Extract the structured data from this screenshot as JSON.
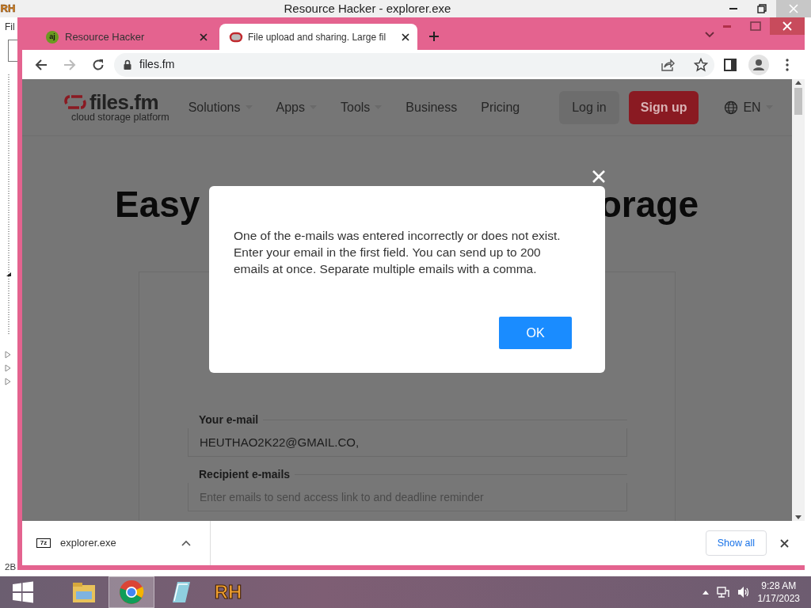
{
  "background_window": {
    "icon_text": "RH",
    "title": "Resource Hacker - explorer.exe",
    "menu_fragment": "Fil",
    "status_fragment": "2B"
  },
  "browser": {
    "tabs": [
      {
        "title": "Resource Hacker",
        "favicon_text": "aj",
        "selected": false
      },
      {
        "title": "File upload and sharing. Large fil",
        "selected": true
      }
    ],
    "address": "files.fm"
  },
  "page": {
    "logo": {
      "name": "files.fm",
      "tagline": "cloud storage platform"
    },
    "nav": [
      {
        "label": "Solutions",
        "dropdown": true
      },
      {
        "label": "Apps",
        "dropdown": true
      },
      {
        "label": "Tools",
        "dropdown": true
      },
      {
        "label": "Business",
        "dropdown": false
      },
      {
        "label": "Pricing",
        "dropdown": false
      }
    ],
    "login": "Log in",
    "signup": "Sign up",
    "language": "EN",
    "headline_start": "Easy",
    "headline_end": "orage",
    "fields": [
      {
        "label": "Your e-mail",
        "value": "HEUTHAO2K22@GMAIL.CO,"
      },
      {
        "label": "Recipient e-mails",
        "placeholder": "Enter emails to send access link to and deadline reminder"
      }
    ]
  },
  "dialog": {
    "message": "One of the e-mails was entered incorrectly or does not exist. Enter your email in the first field. You can send up to 200 emails at once. Separate multiple emails with a comma.",
    "button": "OK"
  },
  "downloads": {
    "items": [
      {
        "icon_text": "7z",
        "name": "explorer.exe"
      }
    ],
    "show_all": "Show all"
  },
  "taskbar": {
    "apps": [
      {
        "kind": "folder",
        "selected": false
      },
      {
        "kind": "chrome",
        "selected": true
      },
      {
        "kind": "notepad",
        "selected": false
      },
      {
        "kind": "text",
        "label": "RH",
        "selected": false
      }
    ],
    "time": "9:28 AM",
    "date": "1/17/2023"
  }
}
